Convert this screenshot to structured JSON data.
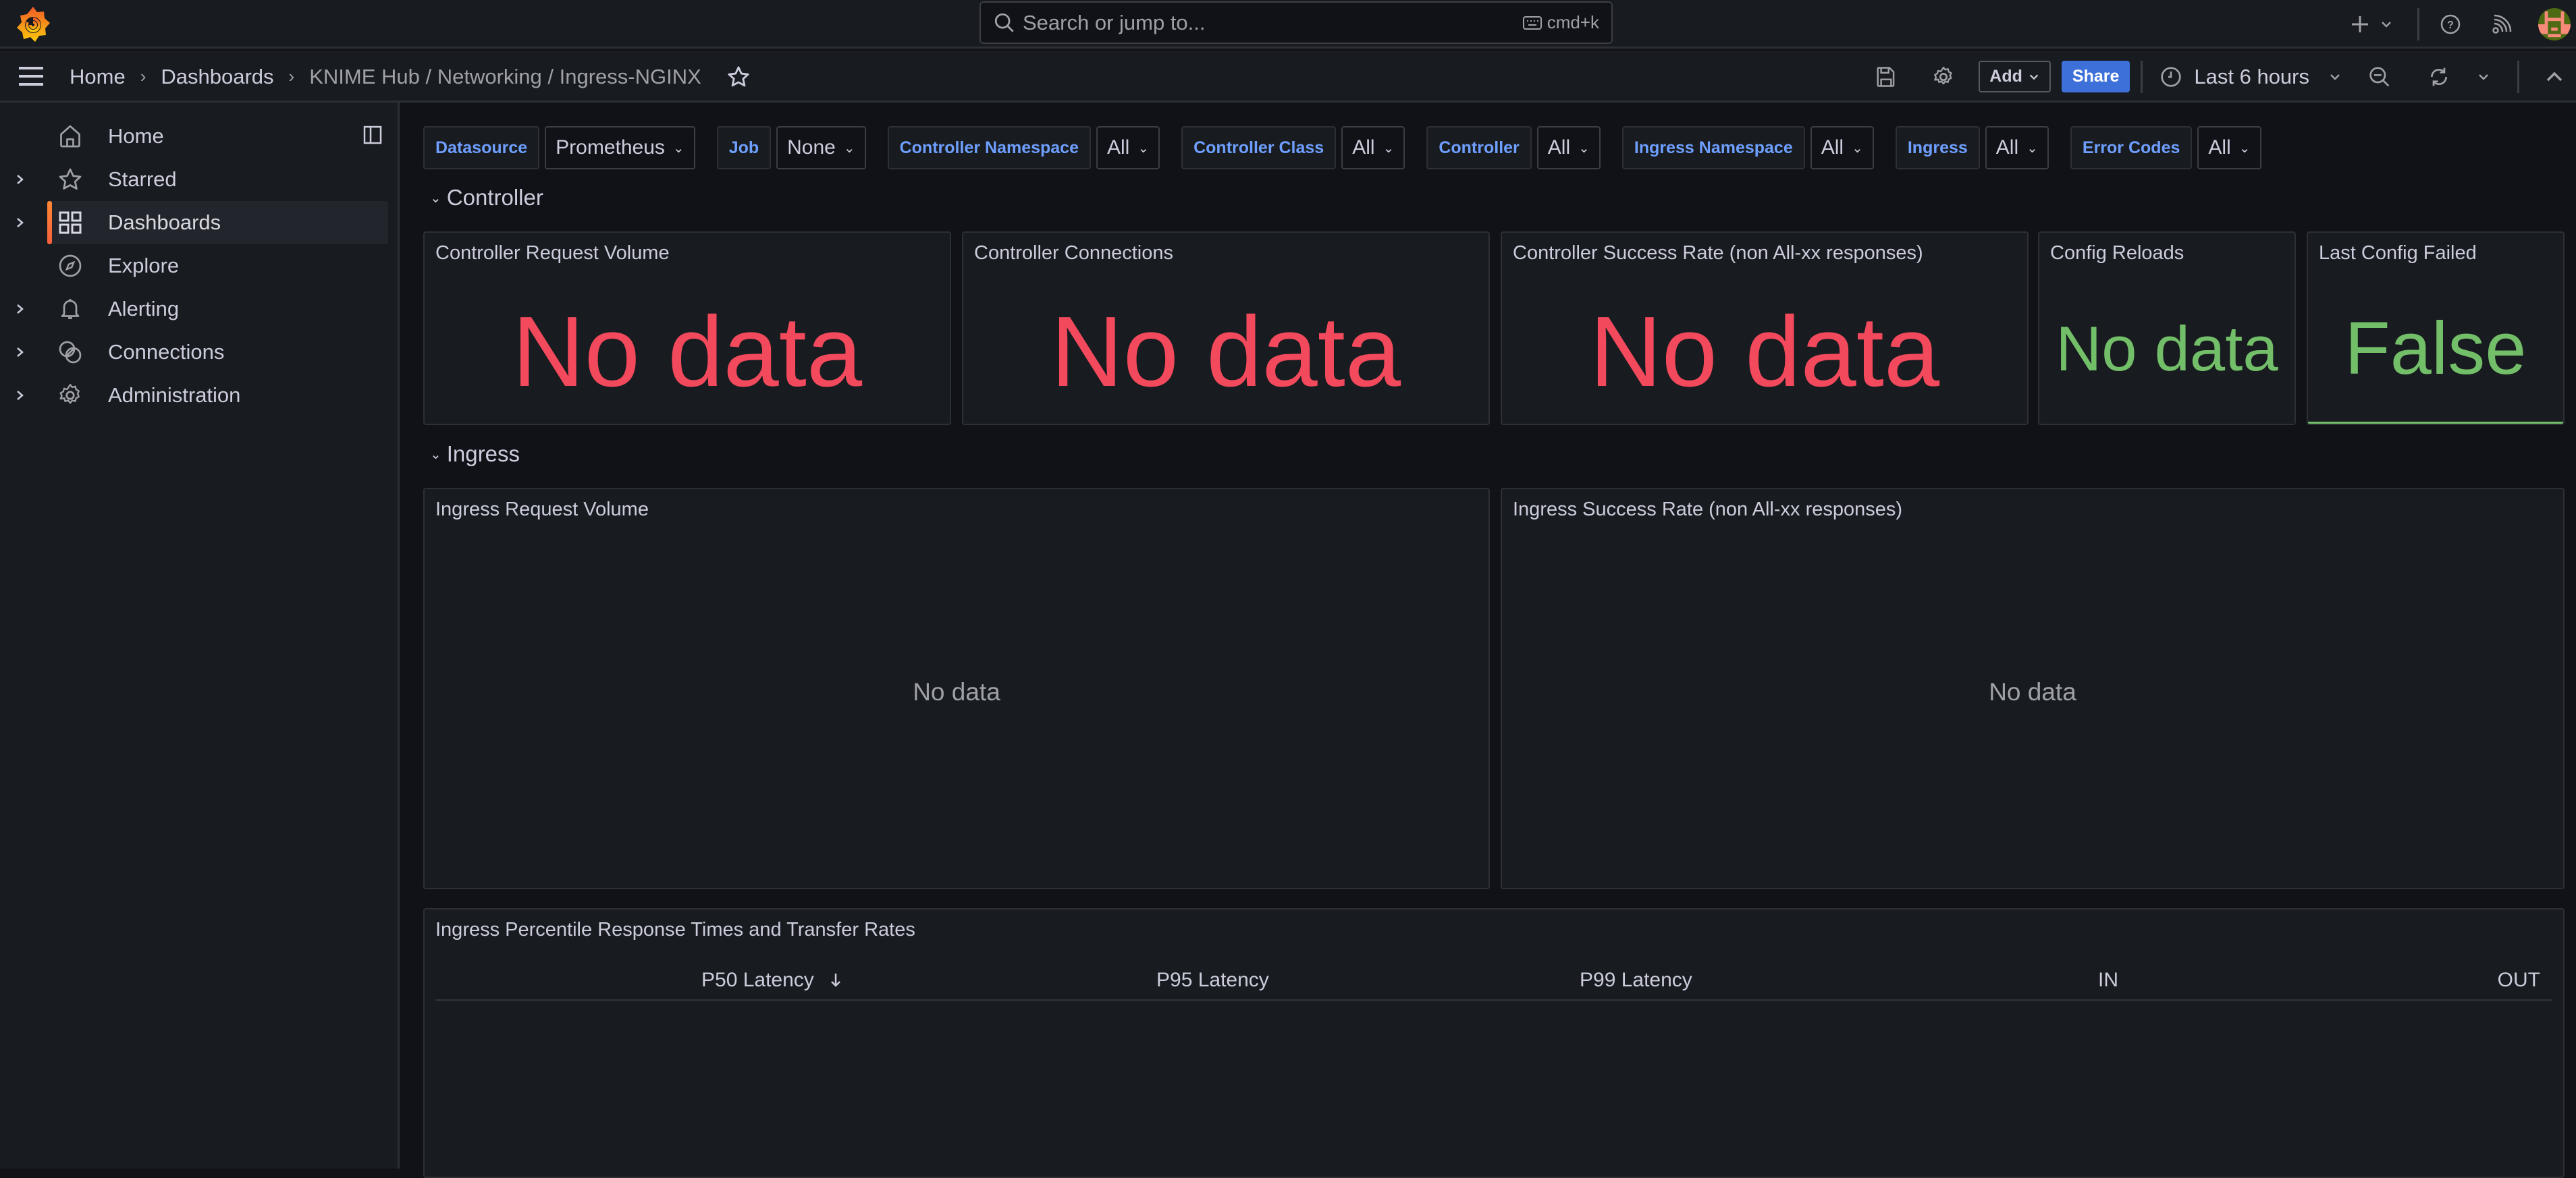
{
  "topbar": {
    "search_placeholder": "Search or jump to...",
    "search_shortcut": "cmd+k",
    "icons": [
      "grafana-logo-icon",
      "plus-icon",
      "chevron-down-icon",
      "help-icon",
      "news-feed-icon",
      "user-avatar"
    ]
  },
  "breadcrumb": {
    "items": [
      "Home",
      "Dashboards",
      "KNIME Hub / Networking / Ingress-NGINX"
    ]
  },
  "toolbar": {
    "add_label": "Add",
    "share_label": "Share",
    "time_range": "Last 6 hours",
    "colors": {
      "share_bg": "#3d71d9"
    }
  },
  "sidebar": {
    "items": [
      {
        "label": "Home",
        "icon": "home-icon",
        "expandable": false,
        "active": false
      },
      {
        "label": "Starred",
        "icon": "star-icon",
        "expandable": true,
        "active": false
      },
      {
        "label": "Dashboards",
        "icon": "dashboards-grid-icon",
        "expandable": true,
        "active": true
      },
      {
        "label": "Explore",
        "icon": "compass-icon",
        "expandable": false,
        "active": false
      },
      {
        "label": "Alerting",
        "icon": "bell-icon",
        "expandable": true,
        "active": false
      },
      {
        "label": "Connections",
        "icon": "connections-icon",
        "expandable": true,
        "active": false
      },
      {
        "label": "Administration",
        "icon": "gear-icon",
        "expandable": true,
        "active": false
      }
    ]
  },
  "variables": [
    {
      "label": "Datasource",
      "value": "Prometheus"
    },
    {
      "label": "Job",
      "value": "None"
    },
    {
      "label": "Controller Namespace",
      "value": "All"
    },
    {
      "label": "Controller Class",
      "value": "All"
    },
    {
      "label": "Controller",
      "value": "All"
    },
    {
      "label": "Ingress Namespace",
      "value": "All"
    },
    {
      "label": "Ingress",
      "value": "All"
    },
    {
      "label": "Error Codes",
      "value": "All"
    }
  ],
  "rows": {
    "controller": "Controller",
    "ingress": "Ingress"
  },
  "stat_panels": [
    {
      "title": "Controller Request Volume",
      "value": "No data",
      "color": "#f2495c"
    },
    {
      "title": "Controller Connections",
      "value": "No data",
      "color": "#f2495c"
    },
    {
      "title": "Controller Success Rate (non All-xx responses)",
      "value": "No data",
      "color": "#f2495c"
    },
    {
      "title": "Config Reloads",
      "value": "No data",
      "color": "#73bf69"
    },
    {
      "title": "Last Config Failed",
      "value": "False",
      "color": "#73bf69"
    }
  ],
  "graph_panels": [
    {
      "title": "Ingress Request Volume",
      "message": "No data"
    },
    {
      "title": "Ingress Success Rate (non All-xx responses)",
      "message": "No data"
    }
  ],
  "table_panel": {
    "title": "Ingress Percentile Response Times and Transfer Rates",
    "columns": [
      "P50 Latency",
      "P95 Latency",
      "P99 Latency",
      "IN",
      "OUT"
    ],
    "sorted_column": "P50 Latency",
    "sort_direction": "descending",
    "rows": []
  }
}
